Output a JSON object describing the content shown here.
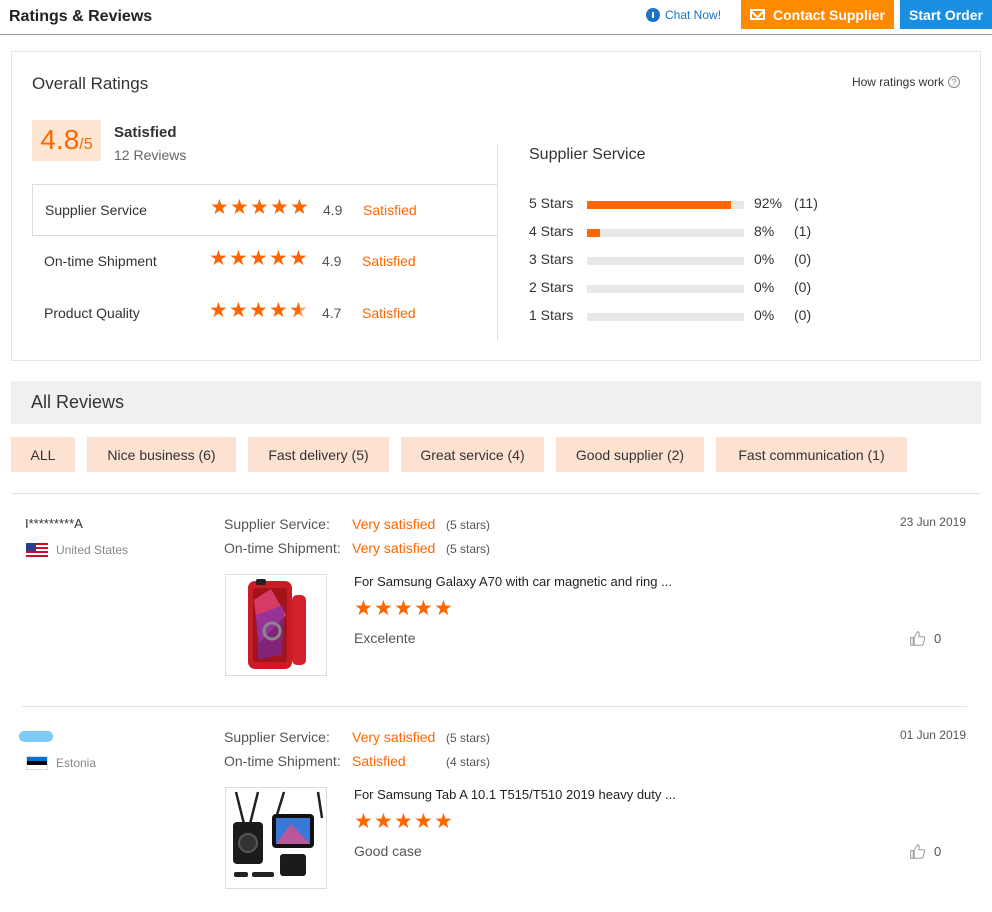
{
  "header": {
    "title": "Ratings & Reviews",
    "chat_label": "Chat Now!",
    "contact_label": "Contact Supplier",
    "order_label": "Start Order"
  },
  "overall": {
    "title": "Overall Ratings",
    "how_ratings": "How ratings work",
    "help_symbol": "?",
    "score": "4.8",
    "score_max": "/5",
    "satisfaction": "Satisfied",
    "reviews_count": "12 Reviews",
    "categories": [
      {
        "label": "Supplier Service",
        "value": "4.9",
        "text": "Satisfied",
        "stars": 5
      },
      {
        "label": "On-time Shipment",
        "value": "4.9",
        "text": "Satisfied",
        "stars": 5
      },
      {
        "label": "Product Quality",
        "value": "4.7",
        "text": "Satisfied",
        "stars": 4.7
      }
    ]
  },
  "supplier_service": {
    "title": "Supplier Service",
    "rows": [
      {
        "label": "5  Stars",
        "percent": "92%",
        "count": "(11)",
        "fill": 0.92
      },
      {
        "label": "4  Stars",
        "percent": "8%",
        "count": "(1)",
        "fill": 0.08
      },
      {
        "label": "3  Stars",
        "percent": "0%",
        "count": "(0)",
        "fill": 0
      },
      {
        "label": "2  Stars",
        "percent": "0%",
        "count": "(0)",
        "fill": 0
      },
      {
        "label": "1  Stars",
        "percent": "0%",
        "count": "(0)",
        "fill": 0
      }
    ]
  },
  "all_reviews": {
    "title": "All Reviews",
    "filters": [
      "ALL",
      "Nice business (6)",
      "Fast delivery (5)",
      "Great service (4)",
      "Good supplier (2)",
      "Fast communication (1)"
    ]
  },
  "reviews": [
    {
      "reviewer": "I*********A",
      "country": "United States",
      "date": "23 Jun 2019",
      "service_label": "Supplier Service:",
      "service_status": "Very satisfied",
      "service_stars": "(5 stars)",
      "shipment_label": "On-time Shipment:",
      "shipment_status": "Very satisfied",
      "shipment_stars": "(5 stars)",
      "product_title": "For Samsung Galaxy A70 with car magnetic and ring ...",
      "rating": 5,
      "text": "Excelente",
      "likes": "0"
    },
    {
      "reviewer": "",
      "country": "Estonia",
      "date": "01 Jun 2019",
      "service_label": "Supplier Service:",
      "service_status": "Very satisfied",
      "service_stars": "(5 stars)",
      "shipment_label": "On-time Shipment:",
      "shipment_status": "Satisfied",
      "shipment_stars": "(4 stars)",
      "product_title": "For Samsung Tab A 10.1 T515/T510 2019 heavy duty ...",
      "rating": 5,
      "text": "Good case",
      "likes": "0"
    }
  ],
  "colors": {
    "accent": "#ff6600",
    "contact_button": "#ff8a00",
    "order_button": "#1a8fe0",
    "filter_bg": "#fde2d2"
  }
}
